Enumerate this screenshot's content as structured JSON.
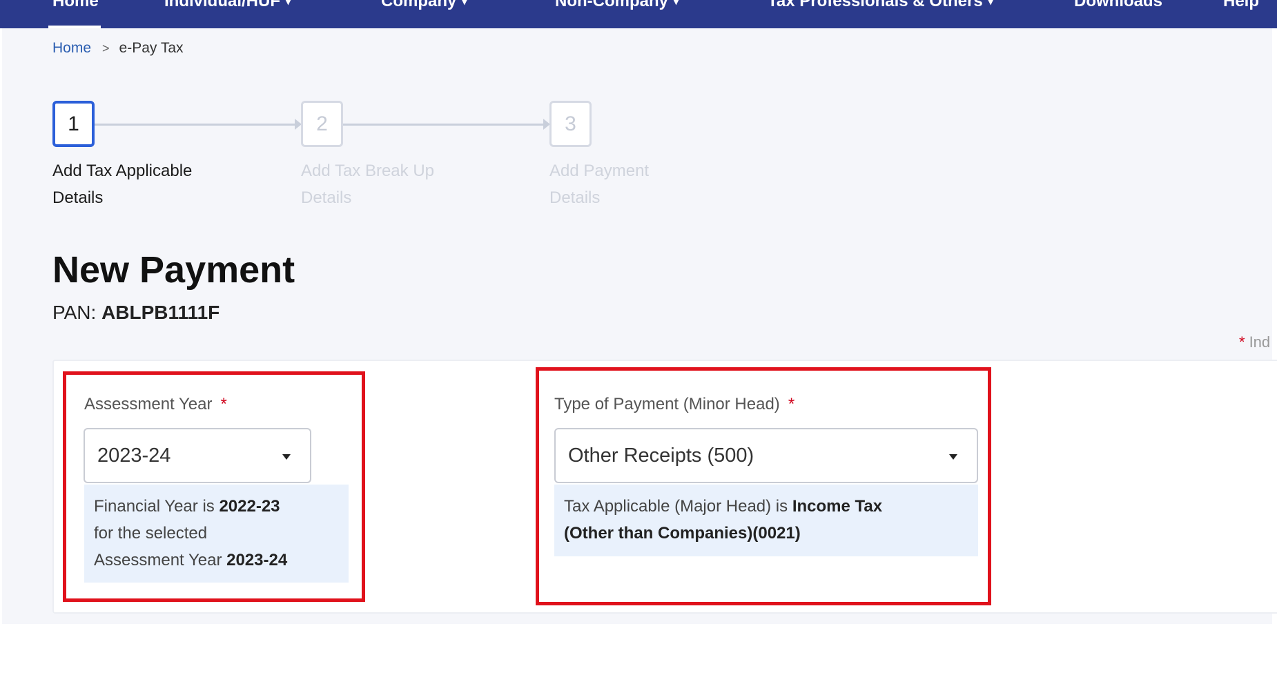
{
  "nav": {
    "items": [
      {
        "label": "Home"
      },
      {
        "label": "Individual/HUF"
      },
      {
        "label": "Company"
      },
      {
        "label": "Non-Company"
      },
      {
        "label": "Tax Professionals & Others"
      },
      {
        "label": "Downloads"
      },
      {
        "label": "Help"
      }
    ]
  },
  "breadcrumb": {
    "home": "Home",
    "separator": ">",
    "current": "e-Pay Tax"
  },
  "stepper": {
    "steps": [
      {
        "number": "1",
        "line1": "Add Tax Applicable",
        "line2": "Details",
        "state": "active"
      },
      {
        "number": "2",
        "line1": "Add Tax Break Up",
        "line2": "Details",
        "state": "inactive"
      },
      {
        "number": "3",
        "line1": "Add Payment",
        "line2": "Details",
        "state": "inactive"
      }
    ]
  },
  "header": {
    "title": "New Payment",
    "pan_label": "PAN:",
    "pan_value": "ABLPB1111F"
  },
  "required_note": {
    "star": "*",
    "text": "Ind"
  },
  "form": {
    "assessment_year": {
      "label": "Assessment Year",
      "required_mark": "*",
      "value": "2023-24",
      "info": {
        "p1": "Financial Year is",
        "fy": "2022-23",
        "p2": "for the selected",
        "p3": "Assessment Year",
        "ay": "2023-24"
      }
    },
    "payment_type": {
      "label": "Type of Payment (Minor Head)",
      "required_mark": "*",
      "value": "Other Receipts (500)",
      "info": {
        "p1": "Tax Applicable (Major Head) is",
        "major_head_1": "Income Tax",
        "major_head_2": "(Other than Companies)(0021)"
      }
    }
  },
  "colors": {
    "nav_bg": "#2b3a8c",
    "accent": "#2b5fd9",
    "highlight": "#e0121c",
    "required": "#d0021b",
    "info_bg": "#e9f1fc"
  }
}
